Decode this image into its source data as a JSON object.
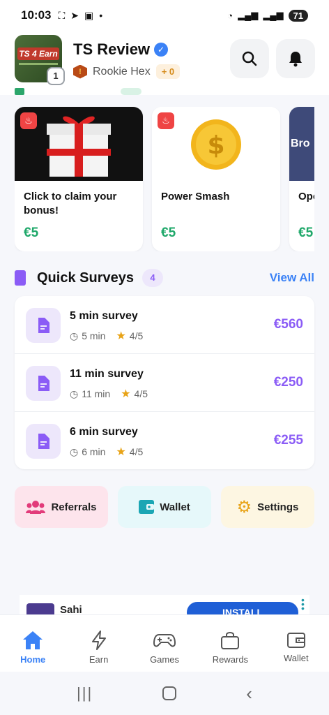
{
  "status_bar": {
    "time": "10:03",
    "battery": "71"
  },
  "header": {
    "app_name": "TS Review",
    "level": "1",
    "rank": "Rookie Hex",
    "points": "+ 0",
    "logo_text": "TS 4 Earn"
  },
  "offers": [
    {
      "title": "Click to claim your bonus!",
      "price": "€5"
    },
    {
      "title": "Power Smash",
      "price": "€5"
    },
    {
      "title": "Ope",
      "price": "€5",
      "image_text": "Bro"
    }
  ],
  "quick_surveys": {
    "title": "Quick Surveys",
    "count": "4",
    "view_all": "View All",
    "items": [
      {
        "title": "5 min survey",
        "duration": "5 min",
        "rating": "4/5",
        "amount": "€560"
      },
      {
        "title": "11 min survey",
        "duration": "11 min",
        "rating": "4/5",
        "amount": "€250"
      },
      {
        "title": "6 min survey",
        "duration": "6 min",
        "rating": "4/5",
        "amount": "€255"
      }
    ]
  },
  "quick_actions": {
    "referrals": "Referrals",
    "wallet": "Wallet",
    "settings": "Settings"
  },
  "ad": {
    "name": "Sahi",
    "install": "INSTALL"
  },
  "nav": {
    "home": "Home",
    "earn": "Earn",
    "games": "Games",
    "rewards": "Rewards",
    "wallet": "Wallet"
  },
  "colors": {
    "accent": "#3b82f6",
    "purple": "#8b5cf6",
    "green": "#1fa86a"
  }
}
